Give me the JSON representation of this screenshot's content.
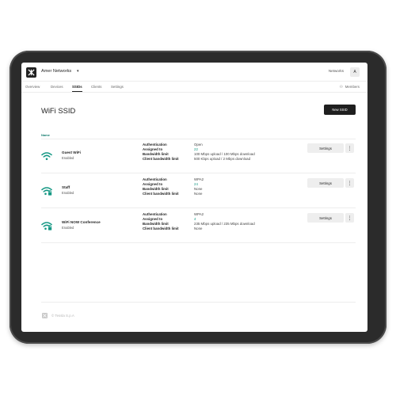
{
  "header": {
    "org_name": "Amer Networks",
    "org_caret": "▾",
    "networks_link": "Networks",
    "avatar_initial": "A"
  },
  "tabs": [
    {
      "label": "Overview",
      "active": false
    },
    {
      "label": "Devices",
      "active": false
    },
    {
      "label": "SSIDs",
      "active": true
    },
    {
      "label": "Clients",
      "active": false
    },
    {
      "label": "Settings",
      "active": false
    }
  ],
  "members_link": "Members",
  "page": {
    "title": "WiFi SSID",
    "new_button": "New SSID",
    "column_header": "Name"
  },
  "detail_labels": {
    "authentication": "Authentication",
    "assigned_to": "Assigned to",
    "bandwidth_limit": "Bandwidth limit",
    "client_bandwidth_limit": "Client bandwidth limit"
  },
  "ssids": [
    {
      "name": "Guest WiFi",
      "status": "Enabled",
      "icon": "wifi-icon",
      "authentication": "Open",
      "assigned_to": "22",
      "bandwidth_limit": "100 Mbps upload / 100 Mbps download",
      "client_bandwidth_limit": "500 Kbps upload / 2 Mbps download",
      "settings_label": "Settings",
      "more_label": "⋮"
    },
    {
      "name": "Staff",
      "status": "Enabled",
      "icon": "wifi-lock-icon",
      "authentication": "WPA2",
      "assigned_to": "24",
      "bandwidth_limit": "None",
      "client_bandwidth_limit": "None",
      "settings_label": "Settings",
      "more_label": "⋮"
    },
    {
      "name": "WiFi NOW Conference",
      "status": "Enabled",
      "icon": "wifi-lock-icon",
      "authentication": "WPA2",
      "assigned_to": "4",
      "bandwidth_limit": "235 Mbps upload / 235 Mbps download",
      "client_bandwidth_limit": "None",
      "settings_label": "Settings",
      "more_label": "⋮"
    }
  ],
  "footer": {
    "company": "© Tessla S.p.A"
  },
  "colors": {
    "accent": "#159884",
    "primary_button": "#1f1f1f",
    "frame": "#2b2b2b"
  }
}
